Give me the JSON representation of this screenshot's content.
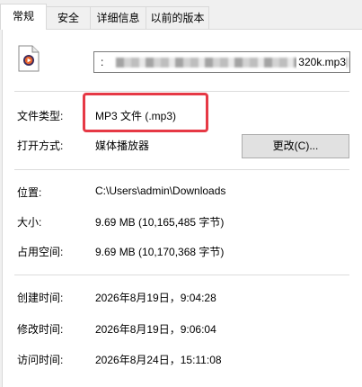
{
  "tabs": [
    "常规",
    "安全",
    "详细信息",
    "以前的版本"
  ],
  "file": {
    "name_prefix": ":",
    "name_suffix": "320k.mp3",
    "icon": "media-file-icon"
  },
  "properties": {
    "type_label": "文件类型:",
    "type_value": "MP3 文件 (.mp3)",
    "opens_label": "打开方式:",
    "opens_value": "媒体播放器",
    "change_button": "更改(C)...",
    "location_label": "位置:",
    "location_value": "C:\\Users\\admin\\Downloads",
    "size_label": "大小:",
    "size_value": "9.69 MB (10,165,485 字节)",
    "disk_label": "占用空间:",
    "disk_value": "9.69 MB (10,170,368 字节)",
    "created_label": "创建时间:",
    "created_value": "2026年8月19日，9:04:28",
    "modified_label": "修改时间:",
    "modified_value": "2026年8月19日，9:06:04",
    "accessed_label": "访问时间:",
    "accessed_value": "2026年8月24日，15:11:08"
  },
  "colors": {
    "highlight": "#e63945"
  }
}
